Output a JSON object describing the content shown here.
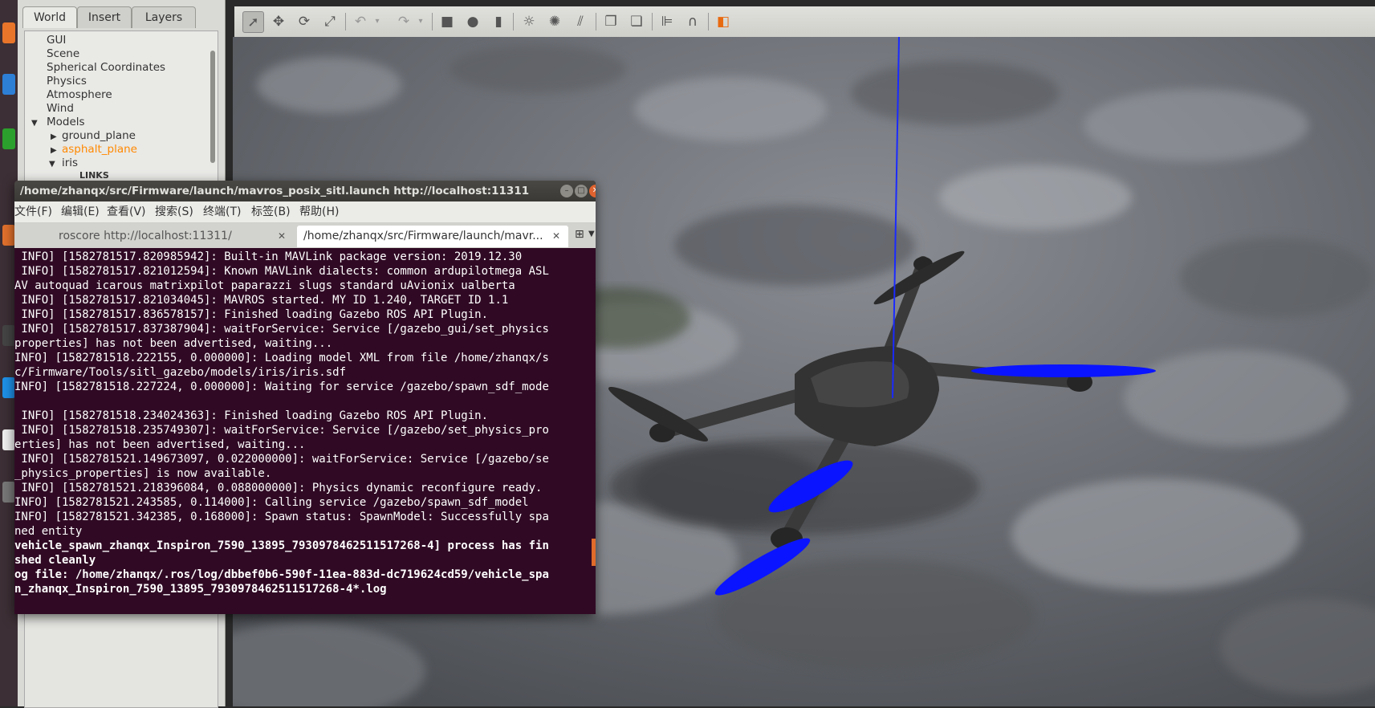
{
  "left_panel": {
    "tabs": [
      "World",
      "Insert",
      "Layers"
    ],
    "tree": {
      "items": [
        "GUI",
        "Scene",
        "Spherical Coordinates",
        "Physics",
        "Atmosphere",
        "Wind"
      ],
      "models_label": "Models",
      "models": [
        "ground_plane",
        "asphalt_plane",
        "iris"
      ],
      "selected": "asphalt_plane",
      "iris_child": "LINKS"
    }
  },
  "toolbar": {
    "icons": [
      "select-mode-icon",
      "translate-icon",
      "rotate-icon",
      "scale-icon",
      "undo-icon",
      "dropdown-icon",
      "redo-icon",
      "dropdown-icon",
      "box-icon",
      "sphere-icon",
      "cylinder-icon",
      "point-light-icon",
      "spot-light-icon",
      "directional-light-icon",
      "copy-icon",
      "paste-icon",
      "align-icon",
      "snap-icon",
      "view-angle-icon"
    ]
  },
  "terminal": {
    "title": "/home/zhanqx/src/Firmware/launch/mavros_posix_sitl.launch http://localhost:11311",
    "menu": [
      "文件(F)",
      "编辑(E)",
      "查看(V)",
      "搜索(S)",
      "终端(T)",
      "标签(B)",
      "帮助(H)"
    ],
    "tabs": [
      "roscore http://localhost:11311/",
      "/home/zhanqx/src/Firmware/launch/mavr..."
    ],
    "active_tab_index": 1,
    "lines": [
      " INFO] [1582781517.820985942]: Built-in MAVLink package version: 2019.12.30",
      " INFO] [1582781517.821012594]: Known MAVLink dialects: common ardupilotmega ASL",
      "AV autoquad icarous matrixpilot paparazzi slugs standard uAvionix ualberta",
      " INFO] [1582781517.821034045]: MAVROS started. MY ID 1.240, TARGET ID 1.1",
      " INFO] [1582781517.836578157]: Finished loading Gazebo ROS API Plugin.",
      " INFO] [1582781517.837387904]: waitForService: Service [/gazebo_gui/set_physics",
      "properties] has not been advertised, waiting...",
      "INFO] [1582781518.222155, 0.000000]: Loading model XML from file /home/zhanqx/s",
      "c/Firmware/Tools/sitl_gazebo/models/iris/iris.sdf",
      "INFO] [1582781518.227224, 0.000000]: Waiting for service /gazebo/spawn_sdf_mode",
      "",
      " INFO] [1582781518.234024363]: Finished loading Gazebo ROS API Plugin.",
      " INFO] [1582781518.235749307]: waitForService: Service [/gazebo/set_physics_pro",
      "erties] has not been advertised, waiting...",
      " INFO] [1582781521.149673097, 0.022000000]: waitForService: Service [/gazebo/se",
      "_physics_properties] is now available.",
      " INFO] [1582781521.218396084, 0.088000000]: Physics dynamic reconfigure ready.",
      "INFO] [1582781521.243585, 0.114000]: Calling service /gazebo/spawn_sdf_model",
      "INFO] [1582781521.342385, 0.168000]: Spawn status: SpawnModel: Successfully spa",
      "ned entity",
      "vehicle_spawn_zhanqx_Inspiron_7590_13895_7930978462511517268-4] process has fin",
      "shed cleanly",
      "og file: /home/zhanqx/.ros/log/dbbef0b6-590f-11ea-883d-dc719624cd59/vehicle_spa",
      "n_zhanqx_Inspiron_7590_13895_7930978462511517268-4*.log"
    ],
    "bold_from_index": 20
  },
  "colors": {
    "terminal_bg": "#300a24",
    "selection": "#ff8a00",
    "propeller": "#0a14ff"
  }
}
